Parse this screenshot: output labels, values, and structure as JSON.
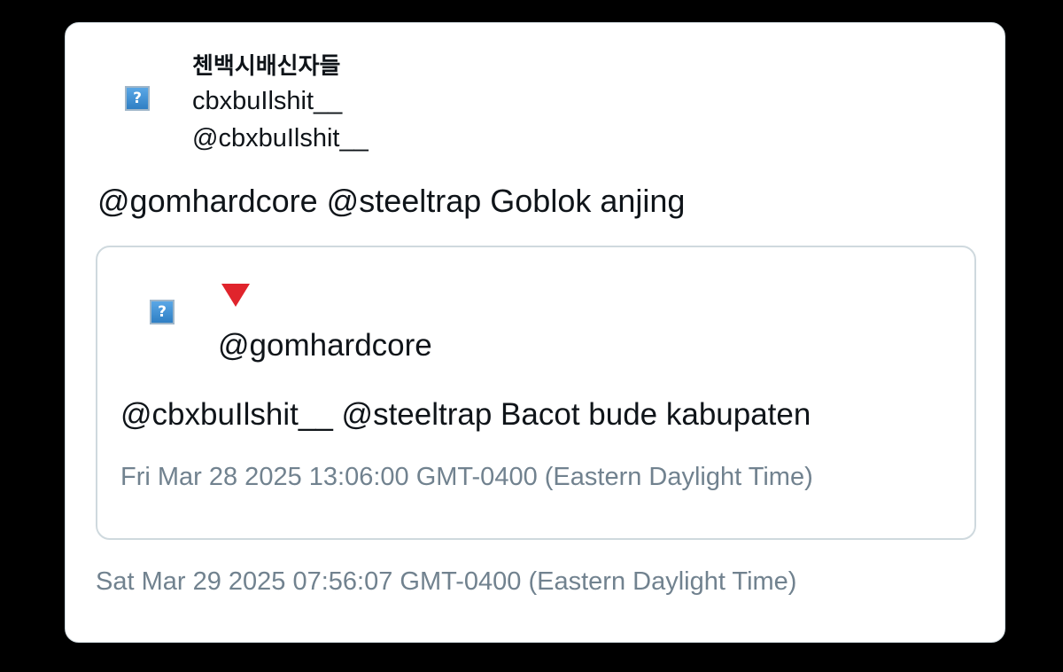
{
  "tweet": {
    "author": {
      "display_name": "첸백시배신자들",
      "name_line2": "cbxbuIlshit__",
      "handle": "@cbxbuIlshit__",
      "avatar_icon": "broken-image-icon"
    },
    "text": "@gomhardcore @steeltrap Goblok anjing",
    "timestamp": "Sat Mar 29 2025 07:56:07 GMT-0400 (Eastern Daylight Time)"
  },
  "quoted_tweet": {
    "author": {
      "display_name_icon": "red-triangle-pointed-down-icon",
      "handle": "@gomhardcore",
      "avatar_icon": "broken-image-icon"
    },
    "text": "@cbxbuIlshit__ @steeltrap Bacot bude kabupaten",
    "timestamp": "Fri Mar 28 2025 13:06:00 GMT-0400 (Eastern Daylight Time)"
  },
  "colors": {
    "background": "#000000",
    "card": "#ffffff",
    "border": "#cfd9de",
    "text": "#0f1419",
    "muted": "#71828f",
    "emoji": "#e0242c"
  },
  "icons": {
    "broken_image_glyph": "?"
  }
}
